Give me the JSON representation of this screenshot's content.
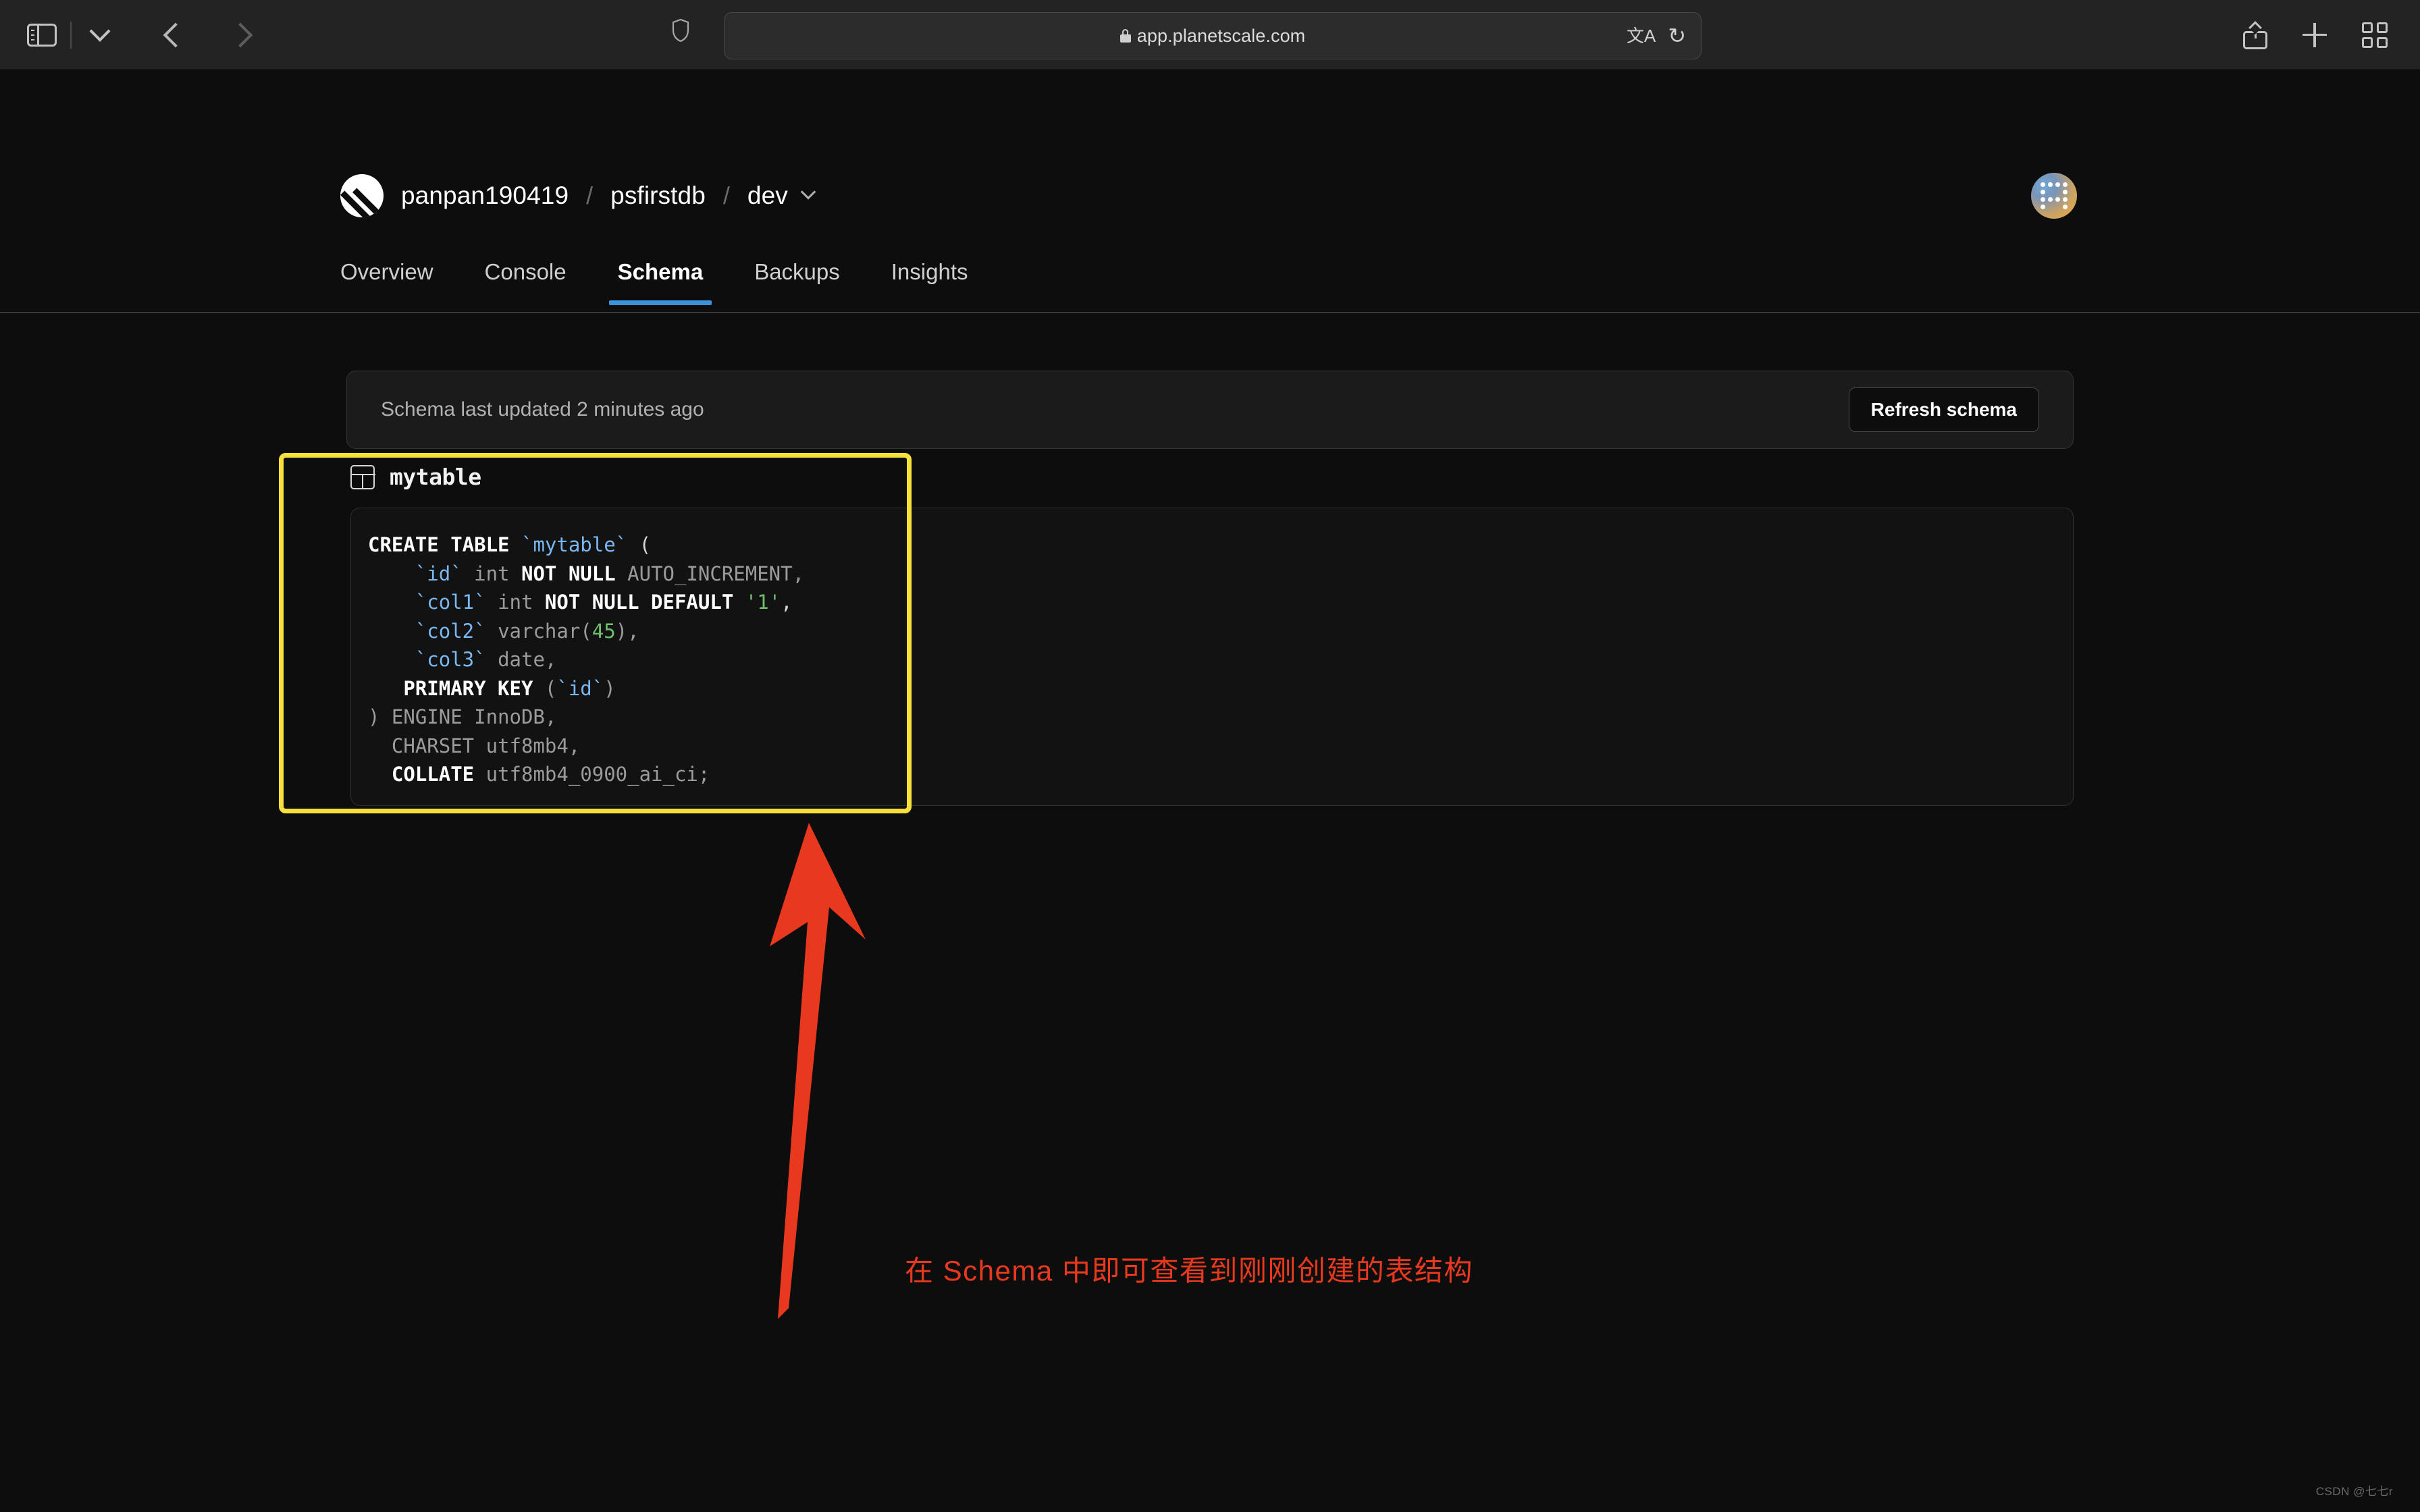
{
  "browser": {
    "url": "app.planetscale.com",
    "sidebar_toggle": "sidebar-toggle",
    "tab_overview": "tab-overview",
    "new_tab": "new-tab",
    "share": "share",
    "back": "back",
    "forward": "forward",
    "reload_glyph": "↻",
    "translate_glyph": "文A"
  },
  "header": {
    "breadcrumb": {
      "organization": "panpan190419",
      "database": "psfirstdb",
      "branch": "dev",
      "separator": "/"
    }
  },
  "nav": {
    "tabs": [
      {
        "label": "Overview",
        "active": false
      },
      {
        "label": "Console",
        "active": false
      },
      {
        "label": "Schema",
        "active": true
      },
      {
        "label": "Backups",
        "active": false
      },
      {
        "label": "Insights",
        "active": false
      }
    ]
  },
  "schema_bar": {
    "status_text": "Schema last updated 2 minutes ago",
    "refresh_label": "Refresh schema"
  },
  "table": {
    "name": "mytable",
    "code_lines": [
      [
        {
          "t": "CREATE TABLE ",
          "c": "k"
        },
        {
          "t": "`mytable`",
          "c": "id"
        },
        {
          "t": " (",
          "c": "pl"
        }
      ],
      [
        {
          "t": "    `id`",
          "c": "id"
        },
        {
          "t": " int ",
          "c": "ty"
        },
        {
          "t": "NOT NULL",
          "c": "k"
        },
        {
          "t": " AUTO_INCREMENT,",
          "c": "ty"
        }
      ],
      [
        {
          "t": "    `col1`",
          "c": "id"
        },
        {
          "t": " int ",
          "c": "ty"
        },
        {
          "t": "NOT NULL DEFAULT ",
          "c": "k"
        },
        {
          "t": "'1'",
          "c": "str"
        },
        {
          "t": ",",
          "c": "pl"
        }
      ],
      [
        {
          "t": "    `col2`",
          "c": "id"
        },
        {
          "t": " varchar(",
          "c": "ty"
        },
        {
          "t": "45",
          "c": "num"
        },
        {
          "t": "),",
          "c": "ty"
        }
      ],
      [
        {
          "t": "    `col3`",
          "c": "id"
        },
        {
          "t": " date,",
          "c": "ty"
        }
      ],
      [
        {
          "t": "   PRIMARY KEY ",
          "c": "k"
        },
        {
          "t": "(",
          "c": "ty"
        },
        {
          "t": "`id`",
          "c": "id"
        },
        {
          "t": ")",
          "c": "ty"
        }
      ],
      [
        {
          "t": ") ENGINE InnoDB,",
          "c": "ty"
        }
      ],
      [
        {
          "t": "  CHARSET utf8mb4,",
          "c": "ty"
        }
      ],
      [
        {
          "t": "  COLLATE",
          "c": "k"
        },
        {
          "t": " utf8mb4_0900_ai_ci;",
          "c": "ty"
        }
      ]
    ]
  },
  "annotation": {
    "text": "在 Schema 中即可查看到刚刚创建的表结构",
    "arrow_color": "#e8391f",
    "highlight_color": "#f5e03c"
  },
  "watermark": "CSDN @七七r"
}
